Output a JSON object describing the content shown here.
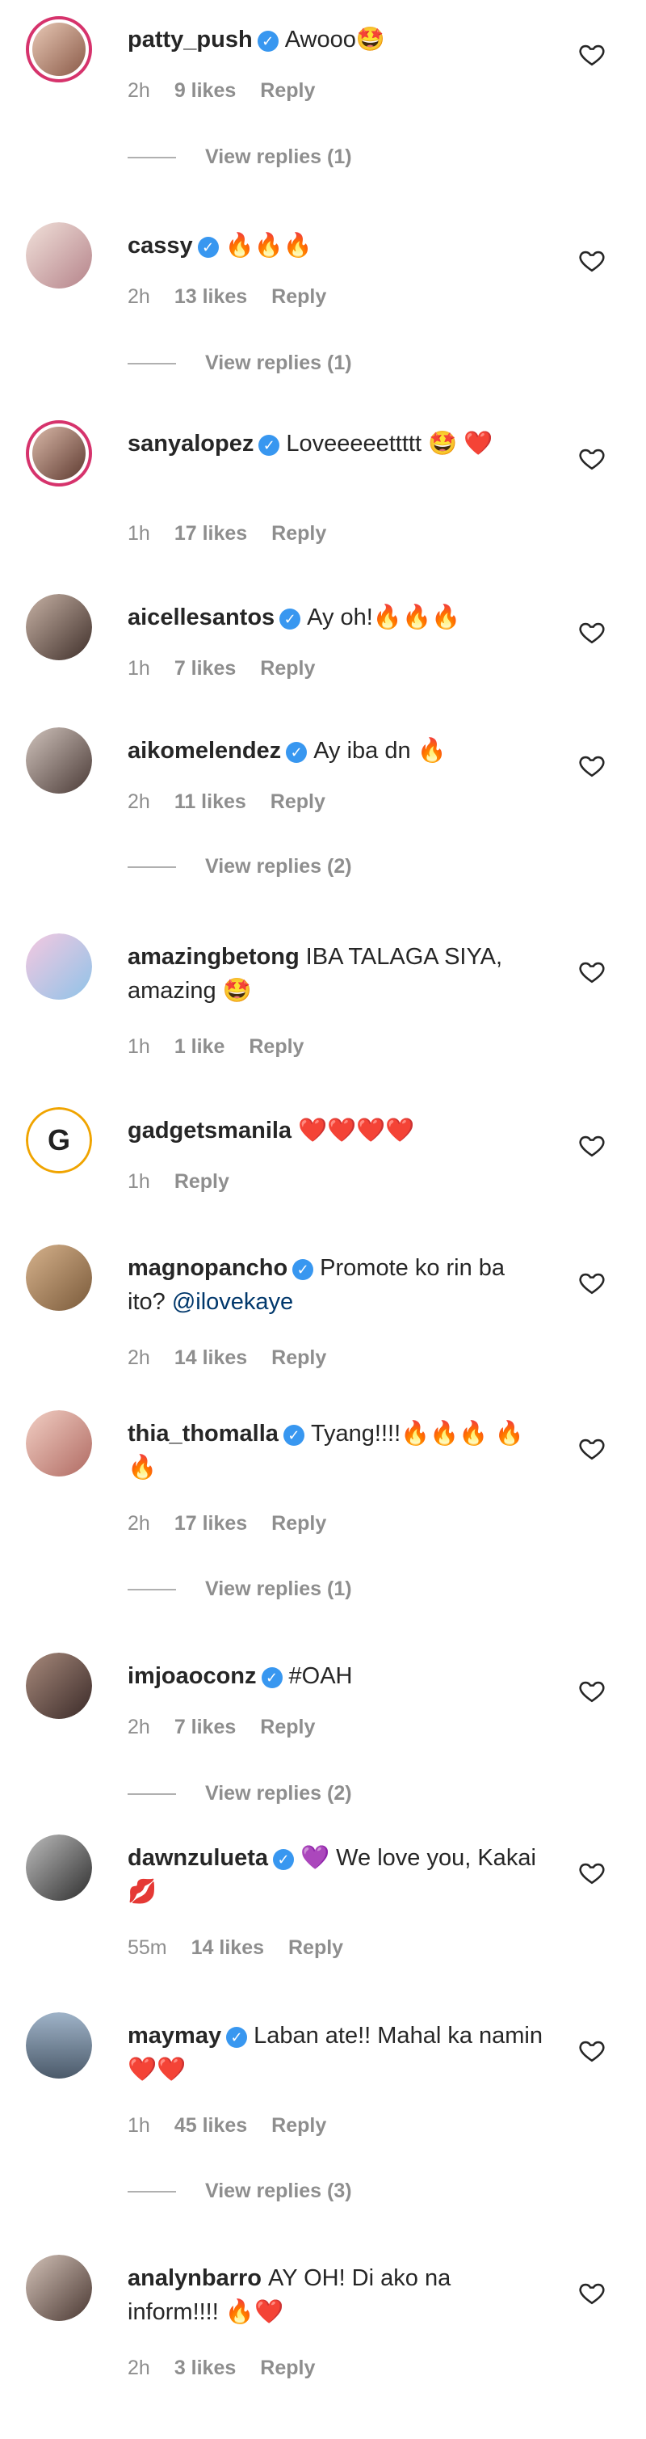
{
  "colors": {
    "ring": "#d6336c",
    "verified": "#3897f0",
    "muted": "#8e8e8e",
    "mention": "#00376b"
  },
  "comments": [
    {
      "user": "patty_push",
      "verified": true,
      "text": "Awooo🤩",
      "time": "2h",
      "likes": "9 likes",
      "reply": "Reply",
      "view_replies": "View replies (1)"
    },
    {
      "user": "cassy",
      "verified": true,
      "text": "🔥🔥🔥",
      "time": "2h",
      "likes": "13 likes",
      "reply": "Reply",
      "view_replies": "View replies (1)"
    },
    {
      "user": "sanyalopez",
      "verified": true,
      "text": "Loveeeeettttt 🤩 ❤️",
      "time": "1h",
      "likes": "17 likes",
      "reply": "Reply"
    },
    {
      "user": "aicellesantos",
      "verified": true,
      "text": "Ay oh!🔥🔥🔥",
      "time": "1h",
      "likes": "7 likes",
      "reply": "Reply"
    },
    {
      "user": "aikomelendez",
      "verified": true,
      "text": "Ay iba dn 🔥",
      "time": "2h",
      "likes": "11 likes",
      "reply": "Reply",
      "view_replies": "View replies (2)"
    },
    {
      "user": "amazingbetong",
      "verified": false,
      "text": "IBA TALAGA SIYA, amazing 🤩",
      "time": "1h",
      "likes": "1 like",
      "reply": "Reply"
    },
    {
      "user": "gadgetsmanila",
      "verified": false,
      "text": "❤️❤️❤️❤️",
      "time": "1h",
      "reply": "Reply"
    },
    {
      "user": "magnopancho",
      "verified": true,
      "text": "Promote ko rin ba ito?",
      "mention": "@ilovekaye",
      "time": "2h",
      "likes": "14 likes",
      "reply": "Reply"
    },
    {
      "user": "thia_thomalla",
      "verified": true,
      "text": "Tyang!!!!🔥🔥🔥 🔥🔥",
      "time": "2h",
      "likes": "17 likes",
      "reply": "Reply",
      "view_replies": "View replies (1)"
    },
    {
      "user": "imjoaoconz",
      "verified": true,
      "text": "#OAH",
      "time": "2h",
      "likes": "7 likes",
      "reply": "Reply",
      "view_replies": "View replies (2)"
    },
    {
      "user": "dawnzulueta",
      "verified": true,
      "text": "💜 We love you, Kakai 💋",
      "time": "55m",
      "likes": "14 likes",
      "reply": "Reply"
    },
    {
      "user": "maymay",
      "verified": true,
      "text": "Laban ate!! Mahal ka namin ❤️❤️",
      "time": "1h",
      "likes": "45 likes",
      "reply": "Reply",
      "view_replies": "View replies (3)"
    },
    {
      "user": "analynbarro",
      "verified": false,
      "text": "AY OH! Di ako na inform!!!! 🔥❤️",
      "time": "2h",
      "likes": "3 likes",
      "reply": "Reply"
    }
  ]
}
